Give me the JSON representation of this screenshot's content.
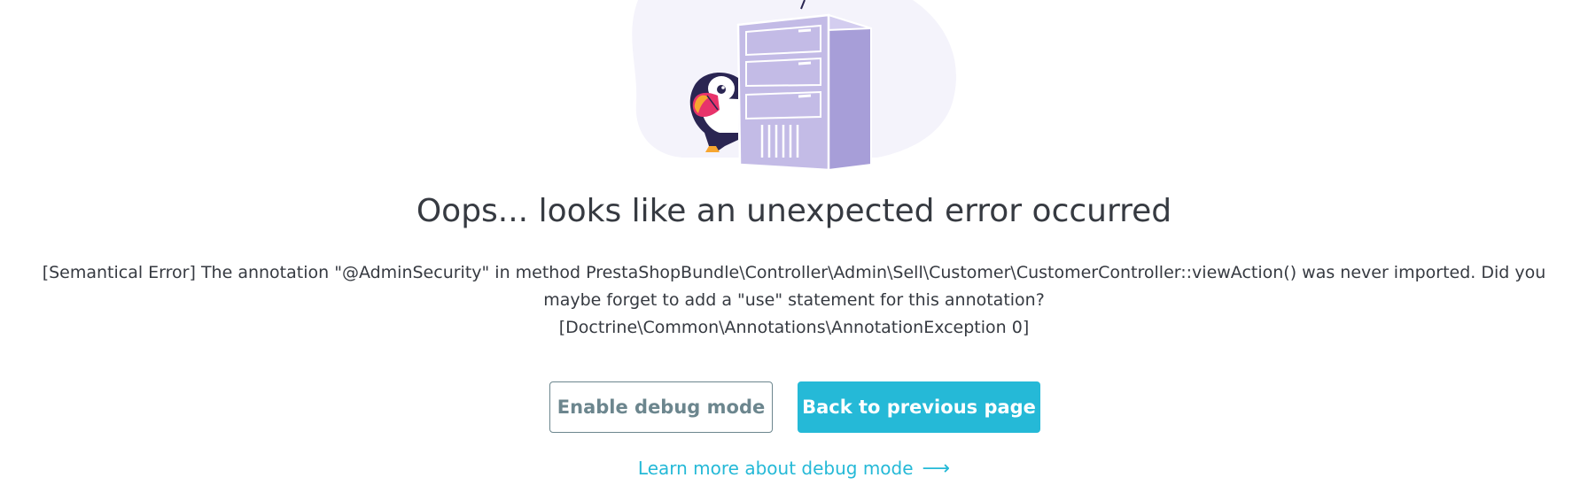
{
  "error_page": {
    "title": "Oops... looks like an unexpected error occurred",
    "message_lines": [
      "[Semantical Error] The annotation \"@AdminSecurity\" in method PrestaShopBundle\\Controller\\Admin\\Sell\\Customer\\CustomerController::viewAction() was never imported. Did you",
      "maybe forget to add a \"use\" statement for this annotation?",
      "[Doctrine\\Common\\Annotations\\AnnotationException 0]"
    ],
    "debug_button_label": "Enable debug mode",
    "back_button_label": "Back to previous page",
    "learn_more_label": "Learn more about debug mode",
    "learn_more_arrow": "⟶"
  },
  "illustration": {
    "subject": "puffin-peeking-behind-server-icon",
    "colors": {
      "blob": "#f4f3fb",
      "server": "#c3bbe6",
      "server_dark": "#a79ed8",
      "outline": "#ffffff",
      "puffin_body": "#2a2552",
      "puffin_beak": "#e8336b",
      "puffin_beak_tip": "#f7a630"
    }
  },
  "colors": {
    "text": "#363a41",
    "accent": "#25b9d7",
    "secondary": "#6c868e"
  }
}
